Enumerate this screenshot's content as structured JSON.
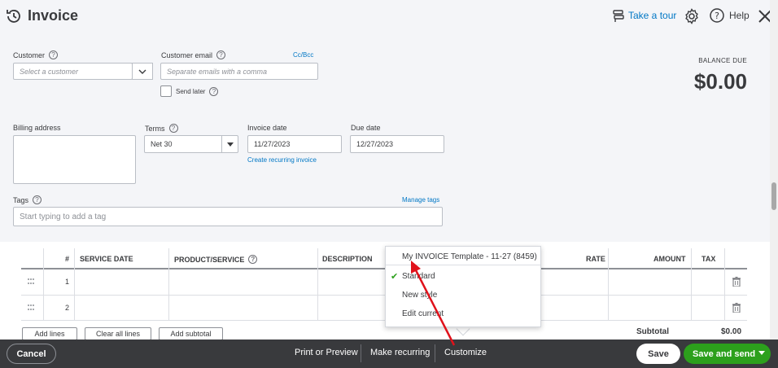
{
  "header": {
    "title": "Invoice",
    "tour_label": "Take a tour",
    "help_label": "Help"
  },
  "customer": {
    "label": "Customer",
    "placeholder": "Select a customer"
  },
  "email": {
    "label": "Customer email",
    "placeholder": "Separate emails with a comma",
    "ccbcc": "Cc/Bcc",
    "send_later": "Send later"
  },
  "balance": {
    "label": "BALANCE DUE",
    "amount": "$0.00"
  },
  "billing": {
    "label": "Billing address"
  },
  "terms": {
    "label": "Terms",
    "value": "Net 30"
  },
  "invoice_date": {
    "label": "Invoice date",
    "value": "11/27/2023",
    "recurring_link": "Create recurring invoice"
  },
  "due_date": {
    "label": "Due date",
    "value": "12/27/2023"
  },
  "tags": {
    "label": "Tags",
    "manage": "Manage tags",
    "placeholder": "Start typing to add a tag"
  },
  "table": {
    "columns": [
      "#",
      "SERVICE DATE",
      "PRODUCT/SERVICE",
      "DESCRIPTION",
      "RATE",
      "AMOUNT",
      "TAX"
    ],
    "rows": [
      "1",
      "2"
    ]
  },
  "actions": {
    "add_lines": "Add lines",
    "clear_lines": "Clear all lines",
    "add_subtotal": "Add subtotal",
    "subtotal_label": "Subtotal",
    "subtotal_value": "$0.00"
  },
  "popup": {
    "items": [
      "My INVOICE Template - 11-27 (8459)",
      "Standard",
      "New style",
      "Edit current"
    ],
    "selected": "Standard"
  },
  "footer": {
    "cancel": "Cancel",
    "print": "Print or Preview",
    "recurring": "Make recurring",
    "customize": "Customize",
    "save": "Save",
    "save_send": "Save and send"
  },
  "colors": {
    "accent": "#0077c5",
    "green": "#2ca01c",
    "footer": "#393a3d",
    "arrow": "#e0121b"
  }
}
